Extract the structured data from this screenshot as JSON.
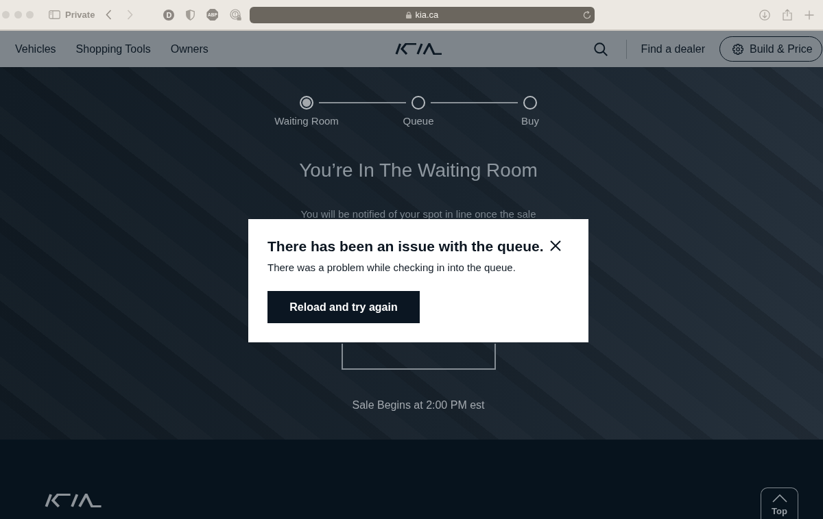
{
  "browser": {
    "private_label": "Private",
    "history_buttons": [
      {
        "kind": "back",
        "disabled": false
      },
      {
        "kind": "forward",
        "disabled": true
      }
    ],
    "extensions": [
      {
        "kind": "letter-circle",
        "label": "D"
      },
      {
        "kind": "shield"
      },
      {
        "kind": "octagon",
        "label": "ABP"
      },
      {
        "kind": "lock-badge"
      }
    ],
    "url": "kia.ca"
  },
  "nav": {
    "links": [
      {
        "label": "Vehicles"
      },
      {
        "label": "Shopping Tools"
      },
      {
        "label": "Owners"
      }
    ],
    "dealer_link": "Find a dealer",
    "build_button": "Build & Price"
  },
  "steps": [
    {
      "label": "Waiting Room",
      "selected": true
    },
    {
      "label": "Queue",
      "selected": false
    },
    {
      "label": "Buy",
      "selected": false
    }
  ],
  "hero": {
    "title": "You’re In The Waiting Room",
    "message": "You will be notified of your spot in line once the sale",
    "sale_time": "Sale Begins at 2:00 PM est"
  },
  "modal": {
    "title": "There has been an issue with the queue.",
    "message": "There was a problem while checking in into the queue.",
    "button": "Reload and try again"
  },
  "footer": {
    "top_button": "Top"
  }
}
